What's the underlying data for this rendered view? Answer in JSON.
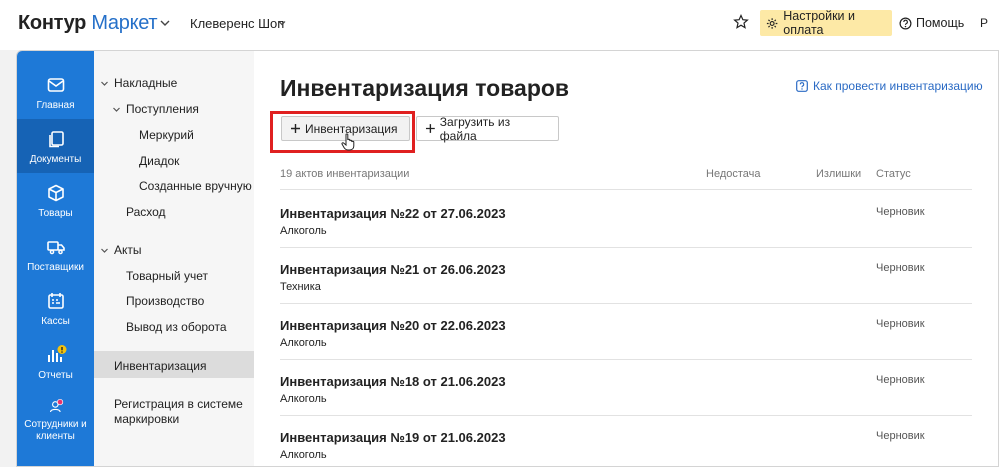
{
  "header": {
    "logo_main": "Контур",
    "logo_sub": "Маркет",
    "shop": "Клеверенс Шоп",
    "settings": "Настройки и оплата",
    "help": "Помощь",
    "user": "Р"
  },
  "nav": [
    {
      "label": "Главная",
      "icon": "mail-icon"
    },
    {
      "label": "Документы",
      "icon": "documents-icon"
    },
    {
      "label": "Товары",
      "icon": "box-icon"
    },
    {
      "label": "Поставщики",
      "icon": "truck-icon"
    },
    {
      "label": "Кассы",
      "icon": "cashbox-icon"
    },
    {
      "label": "Отчеты",
      "icon": "chart-icon"
    },
    {
      "label": "Сотрудники и клиенты",
      "icon": "person-icon"
    }
  ],
  "sidebar": {
    "invoices": "Накладные",
    "receipts": "Поступления",
    "mercury": "Меркурий",
    "diadoc": "Диадок",
    "manual": "Созданные вручную",
    "expense": "Расход",
    "acts": "Акты",
    "goods_account": "Товарный учет",
    "production": "Производство",
    "withdrawal": "Вывод из оборота",
    "inventory": "Инвентаризация",
    "registration": "Регистрация в системе маркировки"
  },
  "main": {
    "title": "Инвентаризация товаров",
    "howto": "Как провести инвентаризацию",
    "btn_inventory": "Инвентаризация",
    "btn_load": "Загрузить из файла",
    "count": "19 актов инвентаризации",
    "col_shortage": "Недостача",
    "col_surplus": "Излишки",
    "col_status": "Статус",
    "rows": [
      {
        "title": "Инвентаризация №22 от 27.06.2023",
        "category": "Алкоголь",
        "status": "Черновик"
      },
      {
        "title": "Инвентаризация №21 от 26.06.2023",
        "category": "Техника",
        "status": "Черновик"
      },
      {
        "title": "Инвентаризация №20 от 22.06.2023",
        "category": "Алкоголь",
        "status": "Черновик"
      },
      {
        "title": "Инвентаризация №18 от 21.06.2023",
        "category": "Алкоголь",
        "status": "Черновик"
      },
      {
        "title": "Инвентаризация №19 от 21.06.2023",
        "category": "Алкоголь",
        "status": "Черновик"
      }
    ]
  },
  "colors": {
    "nav_blue": "#1e79d7",
    "accent_red": "#e02020",
    "settings_bg": "#fde9a6",
    "link": "#2a6ac4"
  }
}
